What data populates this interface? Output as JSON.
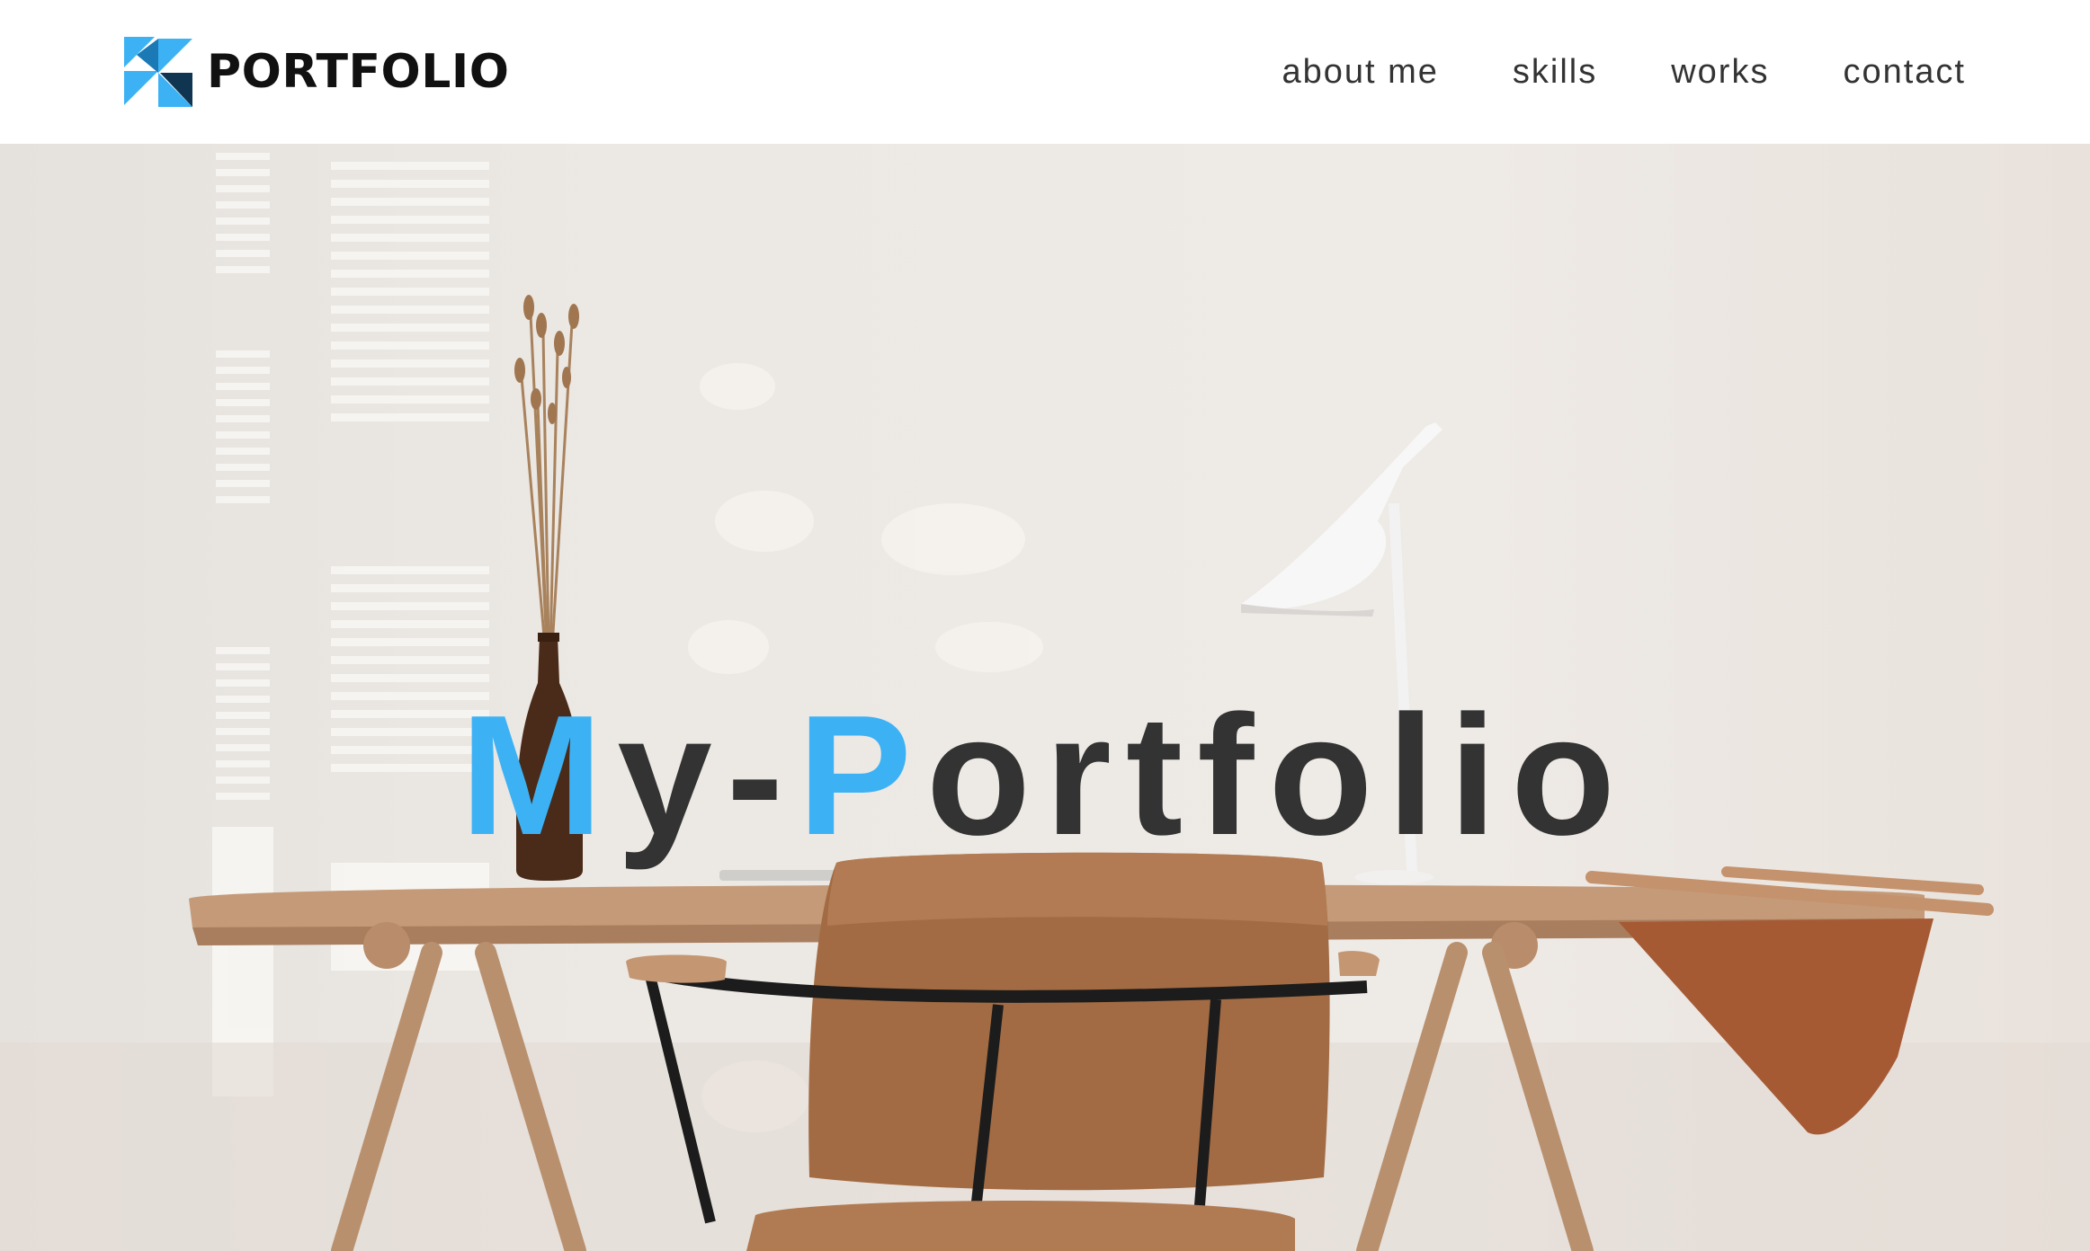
{
  "header": {
    "logo_text": "PORTFOLIO",
    "nav": [
      {
        "label": "about me"
      },
      {
        "label": "skills"
      },
      {
        "label": "works"
      },
      {
        "label": "contact"
      }
    ]
  },
  "hero": {
    "title_parts": [
      "M",
      "y-",
      "P",
      "ortfolio"
    ],
    "accent_color": "#3cb2f5",
    "text_color": "#333333"
  },
  "icons": {
    "logo": "portfolio-logo-mark-icon"
  }
}
